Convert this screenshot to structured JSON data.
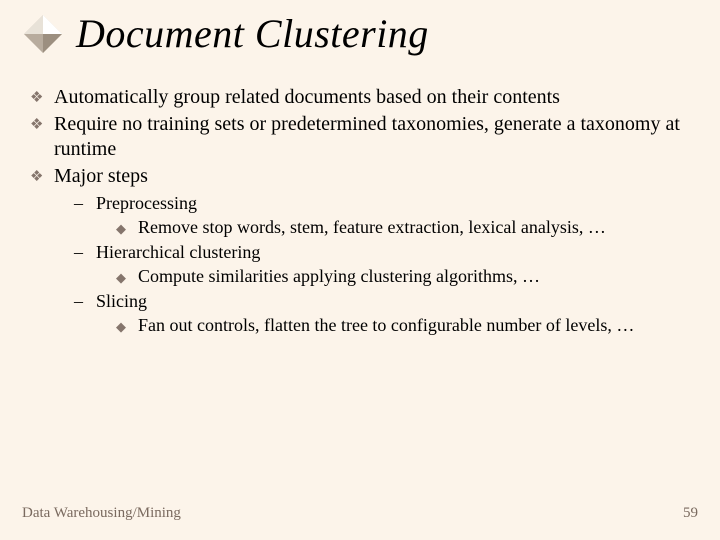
{
  "title": "Document Clustering",
  "bullets": {
    "b1": "Automatically group related documents based on their contents",
    "b2": "Require no training sets or predetermined taxonomies, generate a taxonomy at runtime",
    "b3": "Major steps",
    "s1": "Preprocessing",
    "s1d": "Remove stop words, stem, feature extraction, lexical analysis, …",
    "s2": "Hierarchical clustering",
    "s2d": "Compute similarities applying clustering algorithms, …",
    "s3": "Slicing",
    "s3d": "Fan out controls, flatten the tree to configurable number of levels, …"
  },
  "footer": {
    "left": "Data Warehousing/Mining",
    "right": "59"
  }
}
